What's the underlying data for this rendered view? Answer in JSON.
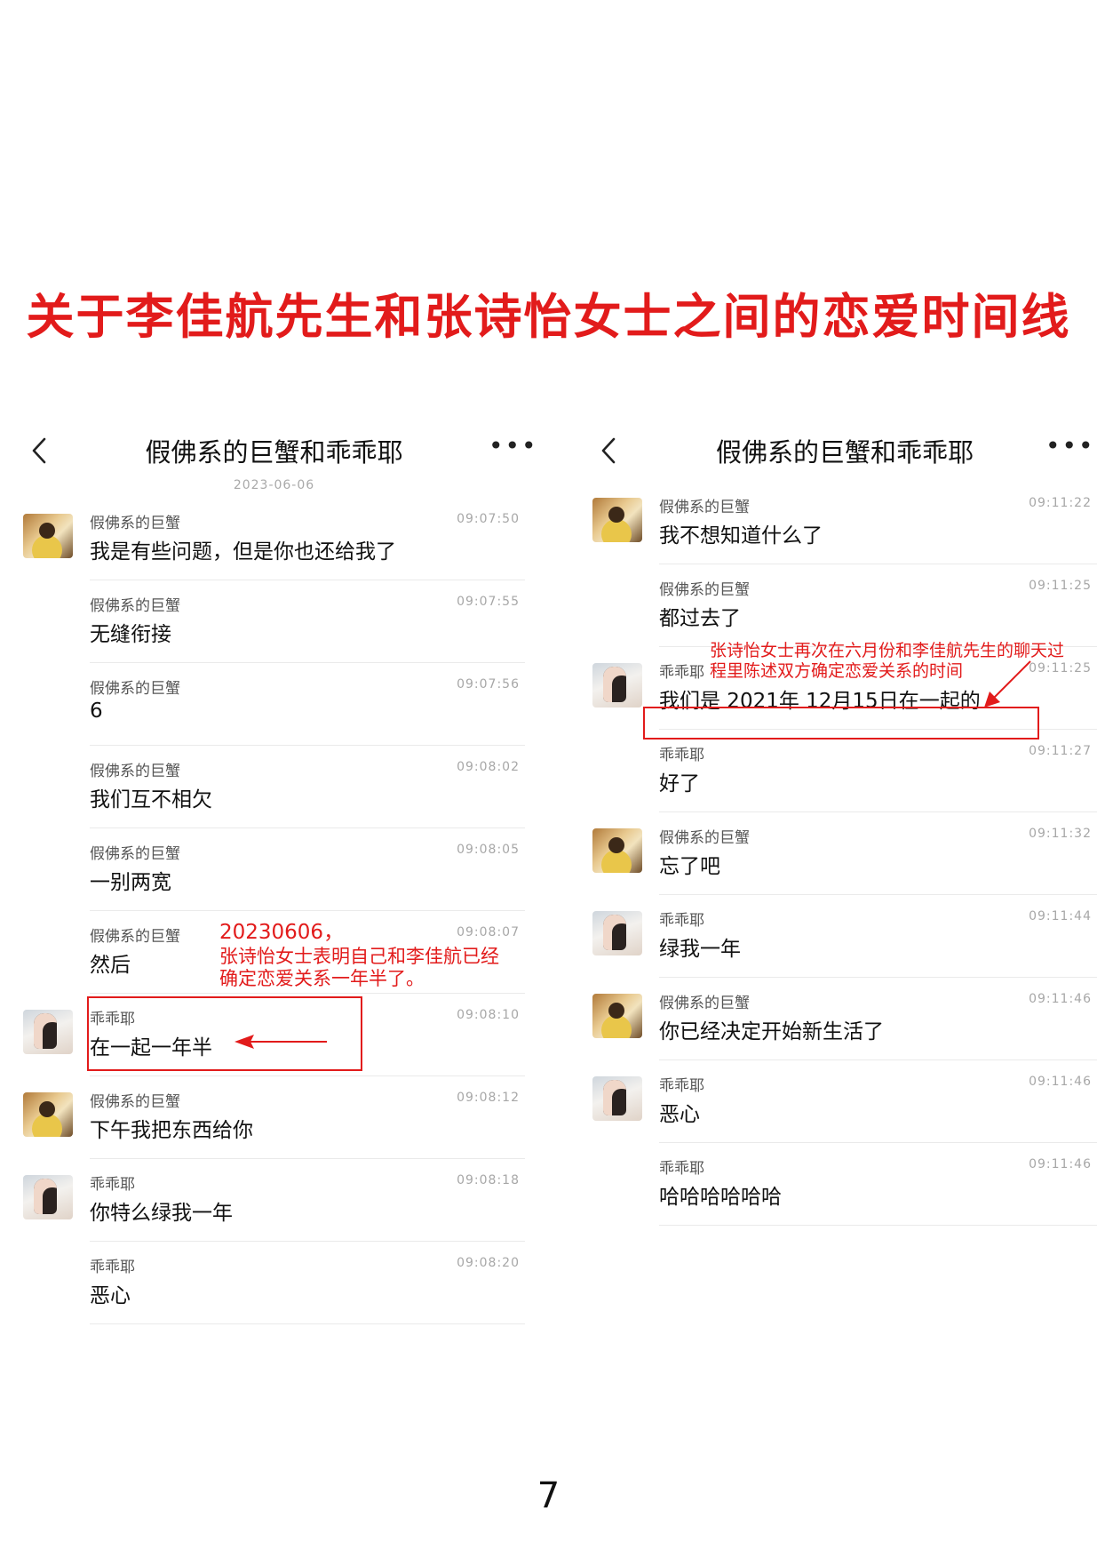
{
  "page_title": "关于李佳航先生和张诗怡女士之间的恋爱时间线",
  "page_number": "7",
  "colors": {
    "annotation": "#e21b1b"
  },
  "left_chat": {
    "title": "假佛系的巨蟹和乖乖耶",
    "back_icon": "chevron-left-icon",
    "more_icon": "more-dots-icon",
    "date": "2023-06-06",
    "messages": [
      {
        "sender": "假佛系的巨蟹",
        "time": "09:07:50",
        "text": "我是有些问题，但是你也还给我了",
        "avatar": "crab"
      },
      {
        "sender": "假佛系的巨蟹",
        "time": "09:07:55",
        "text": "无缝衔接",
        "avatar": ""
      },
      {
        "sender": "假佛系的巨蟹",
        "time": "09:07:56",
        "text": "6",
        "avatar": ""
      },
      {
        "sender": "假佛系的巨蟹",
        "time": "09:08:02",
        "text": "我们互不相欠",
        "avatar": ""
      },
      {
        "sender": "假佛系的巨蟹",
        "time": "09:08:05",
        "text": "一别两宽",
        "avatar": ""
      },
      {
        "sender": "假佛系的巨蟹",
        "time": "09:08:07",
        "text": "然后",
        "avatar": ""
      },
      {
        "sender": "乖乖耶",
        "time": "09:08:10",
        "text": "在一起一年半",
        "avatar": "guai"
      },
      {
        "sender": "假佛系的巨蟹",
        "time": "09:08:12",
        "text": "下午我把东西给你",
        "avatar": "crab"
      },
      {
        "sender": "乖乖耶",
        "time": "09:08:18",
        "text": "你特么绿我一年",
        "avatar": "guai"
      },
      {
        "sender": "乖乖耶",
        "time": "09:08:20",
        "text": "恶心",
        "avatar": ""
      }
    ],
    "annotation": {
      "date_line": "20230606，",
      "line1": "张诗怡女士表明自己和李佳航已经",
      "line2": "确定恋爱关系一年半了。"
    }
  },
  "right_chat": {
    "title": "假佛系的巨蟹和乖乖耶",
    "back_icon": "chevron-left-icon",
    "more_icon": "more-dots-icon",
    "messages": [
      {
        "sender": "假佛系的巨蟹",
        "time": "09:11:22",
        "text": "我不想知道什么了",
        "avatar": "crab"
      },
      {
        "sender": "假佛系的巨蟹",
        "time": "09:11:25",
        "text": "都过去了",
        "avatar": ""
      },
      {
        "sender": "乖乖耶",
        "time": "09:11:25",
        "text": "我们是 2021年 12月15日在一起的",
        "avatar": "guai"
      },
      {
        "sender": "乖乖耶",
        "time": "09:11:27",
        "text": "好了",
        "avatar": ""
      },
      {
        "sender": "假佛系的巨蟹",
        "time": "09:11:32",
        "text": "忘了吧",
        "avatar": "crab"
      },
      {
        "sender": "乖乖耶",
        "time": "09:11:44",
        "text": "绿我一年",
        "avatar": "guai"
      },
      {
        "sender": "假佛系的巨蟹",
        "time": "09:11:46",
        "text": "你已经决定开始新生活了",
        "avatar": "crab"
      },
      {
        "sender": "乖乖耶",
        "time": "09:11:46",
        "text": "恶心",
        "avatar": "guai"
      },
      {
        "sender": "乖乖耶",
        "time": "09:11:46",
        "text": "哈哈哈哈哈哈",
        "avatar": ""
      }
    ],
    "annotation": {
      "line1": "张诗怡女士再次在六月份和李佳航先生的聊天过",
      "line2": "程里陈述双方确定恋爱关系的时间"
    }
  }
}
